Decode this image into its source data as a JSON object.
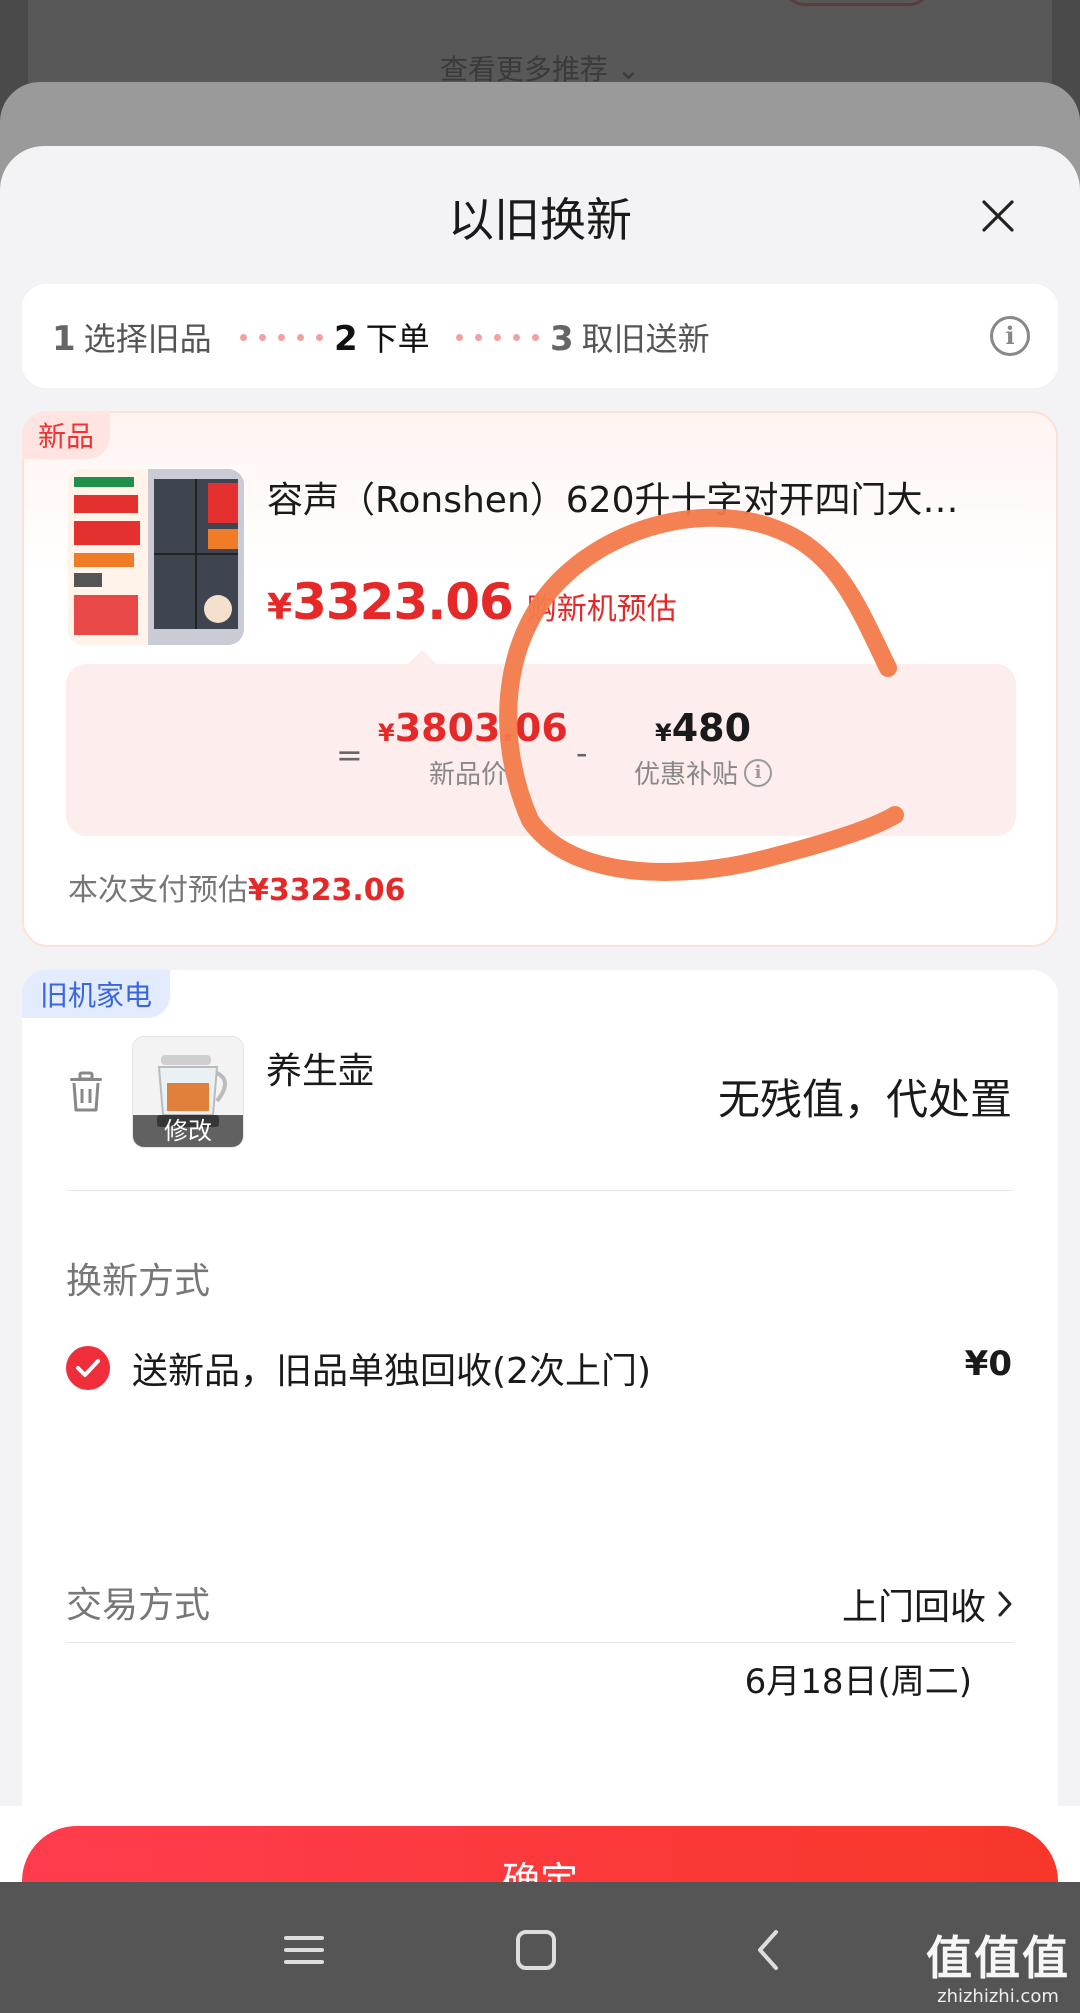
{
  "background": {
    "more_recommendations": "查看更多推荐 ⌄"
  },
  "sheet": {
    "title": "以旧换新"
  },
  "steps": [
    {
      "num": "1",
      "label": "选择旧品"
    },
    {
      "num": "2",
      "label": "下单"
    },
    {
      "num": "3",
      "label": "取旧送新"
    }
  ],
  "new_product": {
    "badge": "新品",
    "name": "容声（Ronshen）620升十字对开四门大…",
    "price_symbol": "¥",
    "price": "3323.06",
    "price_note": "购新机预估",
    "calc": {
      "equals": "=",
      "minus": "-",
      "new_price_symbol": "¥",
      "new_price": "3803.06",
      "new_price_label": "新品价",
      "subsidy_symbol": "¥",
      "subsidy": "480",
      "subsidy_label": "优惠补贴"
    },
    "pay_estimate_label": "本次支付预估",
    "pay_estimate_value": "¥3323.06"
  },
  "old_product": {
    "badge": "旧机家电",
    "name": "养生壶",
    "edit_label": "修改",
    "value_text": "无残值，代处置"
  },
  "exchange_method": {
    "label": "换新方式",
    "option": "送新品，旧品单独回收(2次上门)",
    "option_price": "¥0"
  },
  "trade_method": {
    "label": "交易方式",
    "value": "上门回收",
    "date": "6月18日(周二)"
  },
  "confirm_label": "确定",
  "watermark": {
    "title": "值值值",
    "url": "zhizhizhi.com"
  },
  "colors": {
    "accent_red": "#e52828",
    "button_red": "#ff3c4e",
    "scribble_orange": "#f27a4a"
  }
}
